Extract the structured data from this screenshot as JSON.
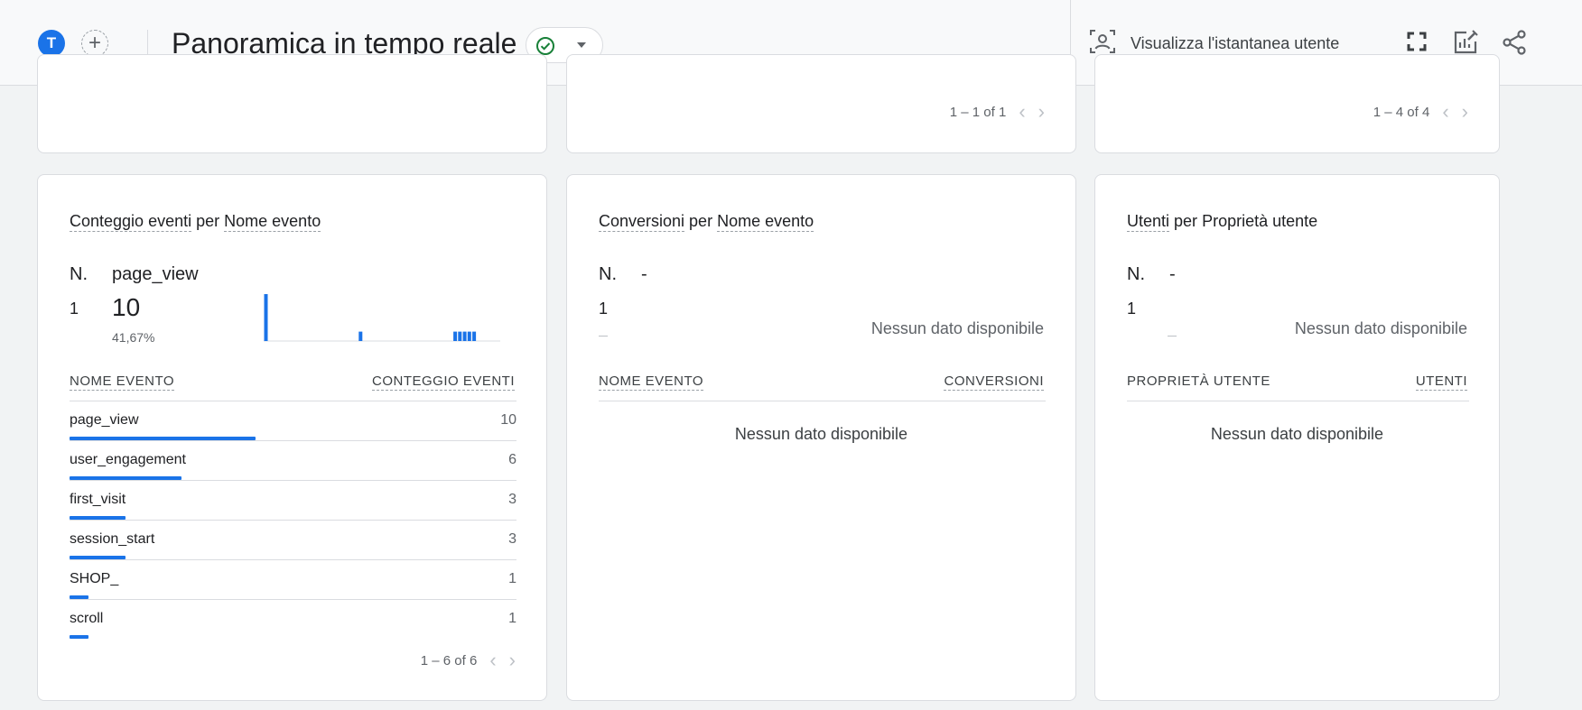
{
  "header": {
    "avatar_letter": "T",
    "add_label": "+",
    "title": "Panoramica in tempo reale",
    "snapshot_label": "Visualizza l'istantanea utente",
    "icons": [
      "user-snapshot-icon",
      "fullscreen-icon",
      "customize-report-icon",
      "share-icon"
    ]
  },
  "top_cards": [
    {
      "pager": ""
    },
    {
      "pager": "1 – 1 of 1"
    },
    {
      "pager": "1 – 4 of 4"
    }
  ],
  "cards": {
    "events": {
      "title_a": "Conteggio eventi",
      "title_mid": " per ",
      "title_b": "Nome evento",
      "rank_label": "N.",
      "top_name": "page_view",
      "top_rank": "1",
      "top_value": "10",
      "top_pct": "41,67%",
      "col_name": "NOME EVENTO",
      "col_value": "CONTEGGIO EVENTI",
      "rows": [
        {
          "name": "page_view",
          "value": "10",
          "share": 1.0
        },
        {
          "name": "user_engagement",
          "value": "6",
          "share": 0.6
        },
        {
          "name": "first_visit",
          "value": "3",
          "share": 0.3
        },
        {
          "name": "session_start",
          "value": "3",
          "share": 0.3
        },
        {
          "name": "SHOP_",
          "value": "1",
          "share": 0.1
        },
        {
          "name": "scroll",
          "value": "1",
          "share": 0.1
        }
      ],
      "pager": "1 – 6 of 6",
      "sparkline": [
        10,
        0,
        0,
        0,
        0,
        0,
        0,
        0,
        0,
        0,
        0,
        0,
        0,
        0,
        0,
        0,
        0,
        0,
        0,
        0,
        2,
        0,
        0,
        0,
        0,
        0,
        0,
        0,
        0,
        0,
        0,
        0,
        0,
        0,
        0,
        0,
        0,
        0,
        0,
        0,
        2,
        2,
        2,
        2,
        2,
        0,
        0,
        0,
        0,
        0
      ]
    },
    "conversions": {
      "title_a": "Conversioni",
      "title_mid": " per ",
      "title_b": "Nome evento",
      "rank_label": "N.",
      "top_name": "-",
      "top_rank": "1",
      "nodata": "Nessun dato disponibile",
      "col_name": "NOME EVENTO",
      "col_value": "CONVERSIONI",
      "table_nodata": "Nessun dato disponibile"
    },
    "users": {
      "title_a": "Utenti",
      "title_mid": " per ",
      "title_b": "Proprietà utente",
      "rank_label": "N.",
      "top_name": "-",
      "top_rank": "1",
      "nodata": "Nessun dato disponibile",
      "col_name": "PROPRIETÀ UTENTE",
      "col_value": "UTENTI",
      "table_nodata": "Nessun dato disponibile"
    }
  },
  "colors": {
    "accent": "#1a73e8",
    "success": "#188038"
  }
}
